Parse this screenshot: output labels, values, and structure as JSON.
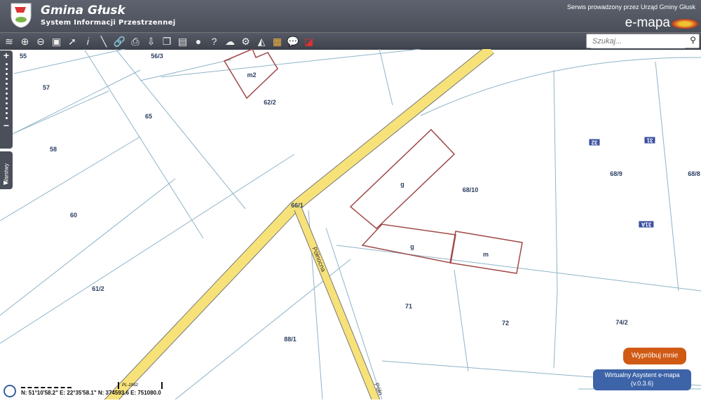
{
  "header": {
    "title": "Gmina Głusk",
    "subtitle": "System Informacji Przestrzennej",
    "service": "Serwis prowadzony przez Urząd Gminy Głusk",
    "brand": "e-mapa"
  },
  "toolbar": {
    "tools": [
      "layers-icon",
      "zoom-in-icon",
      "zoom-out-icon",
      "full-extent-icon",
      "select-arrow-icon",
      "info-icon",
      "measure-ruler-icon",
      "link-icon",
      "print-icon",
      "download-icon",
      "copy-icon",
      "layout-icon",
      "comment-icon",
      "help-icon",
      "cloud-upload-icon",
      "settings-icon",
      "triangle-icon",
      "color-grid-icon",
      "user-chat-icon",
      "red-white-icon"
    ]
  },
  "search": {
    "placeholder": "Szukaj..."
  },
  "zoom": {
    "plus": "+",
    "minus": "−",
    "layers_label": "Warstwy"
  },
  "map": {
    "labels": [
      "55",
      "56/3",
      "57",
      "m2",
      "62/2",
      "65",
      "58",
      "g",
      "68/10",
      "68/9",
      "68/8",
      "66/1",
      "60",
      "g",
      "m",
      "61/2",
      "71",
      "72",
      "74/2",
      "88/1"
    ],
    "numbers": [
      "32",
      "31",
      "31A"
    ],
    "streets": [
      "Północna",
      "Półn"
    ]
  },
  "footer": {
    "crs": "PL-1992",
    "coords": "N: 51°10'58.2\" E: 22°35'58.1\"  N: 374593.6  E: 751080.0"
  },
  "assistant": {
    "try": "Wypróbuj mnie",
    "title": "Wirtualny Asystent e-mapa",
    "version": "(v.0.3.6)"
  },
  "colors": {
    "road": "#f7e27a",
    "building": "#a04848",
    "parcel": "#8fb4c8"
  }
}
